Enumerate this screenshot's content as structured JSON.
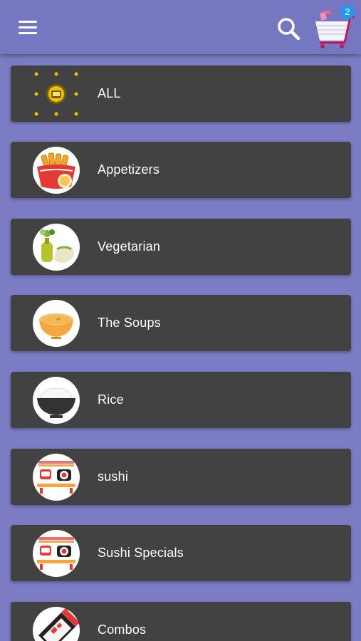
{
  "header": {
    "menu_icon": "hamburger-menu-icon",
    "search_icon": "search-icon",
    "cart_icon": "shopping-cart-icon",
    "cart_count": "2"
  },
  "colors": {
    "background": "#7b7cc4",
    "app_bar": "#7677c1",
    "card": "#424242",
    "badge": "#2196f3"
  },
  "categories": [
    {
      "label": "ALL",
      "icon": "all-categories-icon"
    },
    {
      "label": "Appetizers",
      "icon": "appetizers-icon"
    },
    {
      "label": "Vegetarian",
      "icon": "vegetarian-icon"
    },
    {
      "label": "The Soups",
      "icon": "soup-bowl-icon"
    },
    {
      "label": "Rice",
      "icon": "rice-bowl-icon"
    },
    {
      "label": "sushi",
      "icon": "sushi-icon"
    },
    {
      "label": "Sushi Specials",
      "icon": "sushi-icon"
    },
    {
      "label": "Combos",
      "icon": "combo-box-icon"
    }
  ]
}
